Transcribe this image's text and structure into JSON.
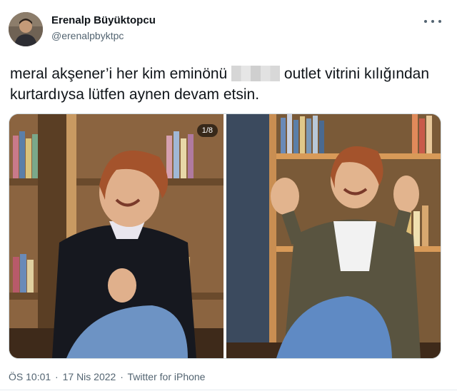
{
  "author": {
    "name": "Erenalp Büyüktopcu",
    "handle": "@erenalpbyktpc",
    "avatar_icon": "profile-photo"
  },
  "more_icon": "more-horizontal-icon",
  "tweet": {
    "text_before": "meral akşener’i her kim eminönü",
    "text_after": "outlet vitrini kılığından kurtardıysa lütfen aynen devam etsin."
  },
  "media": {
    "count_badge": "1/8"
  },
  "meta": {
    "time": "ÖS 10:01",
    "sep1": "·",
    "date": "17 Nis 2022",
    "sep2": "·",
    "source": "Twitter for iPhone"
  }
}
